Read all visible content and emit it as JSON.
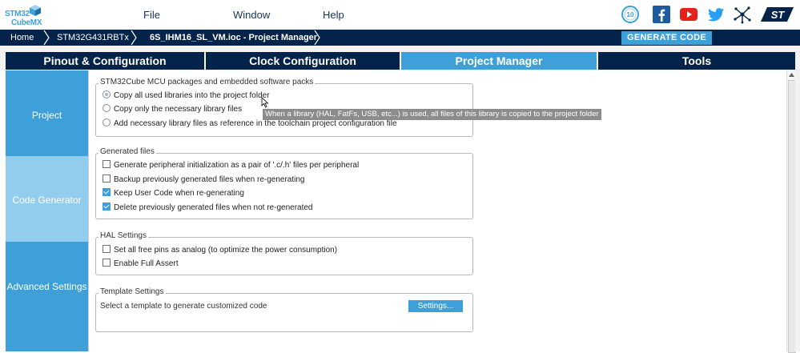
{
  "logo": {
    "line1": "STM32",
    "line2": "CubeMX"
  },
  "menu": {
    "file": "File",
    "window": "Window",
    "help": "Help"
  },
  "social_icons": [
    "anniversary-10-icon",
    "facebook-icon",
    "youtube-icon",
    "twitter-icon",
    "network-icon",
    "st-logo-icon"
  ],
  "badge_text": "10",
  "breadcrumb": {
    "home": "Home",
    "device": "STM32G431RBTx",
    "project": "6S_IHM16_SL_VM.ioc - Project Manager"
  },
  "generate_button": "GENERATE CODE",
  "tabs": [
    "Pinout & Configuration",
    "Clock Configuration",
    "Project Manager",
    "Tools"
  ],
  "active_tab": "Project Manager",
  "sidebar": {
    "items": [
      "Project",
      "Code Generator",
      "Advanced Settings"
    ],
    "selected": "Code Generator"
  },
  "packages": {
    "title": "STM32Cube MCU packages and embedded software packs",
    "options": [
      "Copy all used libraries into the project folder",
      "Copy only the necessary library files",
      "Add necessary library files as reference in the toolchain project configuration file"
    ],
    "selected_index": 0
  },
  "generated_files": {
    "title": "Generated files",
    "options": [
      "Generate peripheral initialization as a pair of '.c/.h' files per peripheral",
      "Backup previously generated files when re-generating",
      "Keep User Code when re-generating",
      "Delete previously generated files when not re-generated"
    ],
    "checked": [
      false,
      false,
      true,
      true
    ]
  },
  "hal_settings": {
    "title": "HAL Settings",
    "options": [
      "Set all free pins as analog (to optimize the power consumption)",
      "Enable Full Assert"
    ],
    "checked": [
      false,
      false
    ]
  },
  "template_settings": {
    "title": "Template Settings",
    "description": "Select a template to generate customized code",
    "button": "Settings..."
  },
  "tooltip": "When a library (HAL, FatFs, USB, etc...) is used, all files of this library is copied to the project folder",
  "colors": {
    "navy": "#03234b",
    "accent": "#3ea0d9",
    "light_accent": "#93cdee"
  }
}
